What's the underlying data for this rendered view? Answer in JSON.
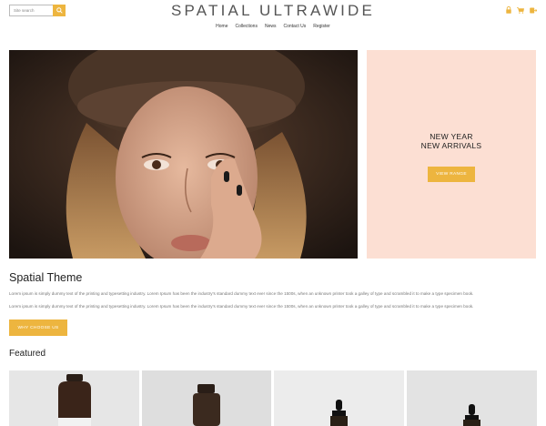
{
  "header": {
    "search_placeholder": "Site search",
    "brand": "SPATIAL ULTRAWIDE",
    "nav": [
      "Home",
      "Collections",
      "News",
      "Contact Us",
      "Register"
    ]
  },
  "hero": {
    "promo_line1": "NEW YEAR",
    "promo_line2": "NEW ARRIVALS",
    "promo_button": "VIEW RANGE"
  },
  "about": {
    "title": "Spatial Theme",
    "para1": "Lorem ipsum is simply dummy text of the printing and typesetting industry. Lorem Ipsum has been the industry's standard dummy text ever since the 1500s, when an unknown printer took a galley of type and scrambled it to make a type specimen book.",
    "para2": "Lorem ipsum is simply dummy text of the printing and typesetting industry. Lorem Ipsum has been the industry's standard dummy text ever since the 1500s, when an unknown printer took a galley of type and scrambled it to make a type specimen book.",
    "button": "WHY CHOOSE US"
  },
  "featured": {
    "title": "Featured"
  },
  "colors": {
    "accent": "#edb53f",
    "promo_bg": "#fcdfd3"
  },
  "icons": [
    "search-icon",
    "lock-icon",
    "cart-icon",
    "checkout-icon"
  ]
}
